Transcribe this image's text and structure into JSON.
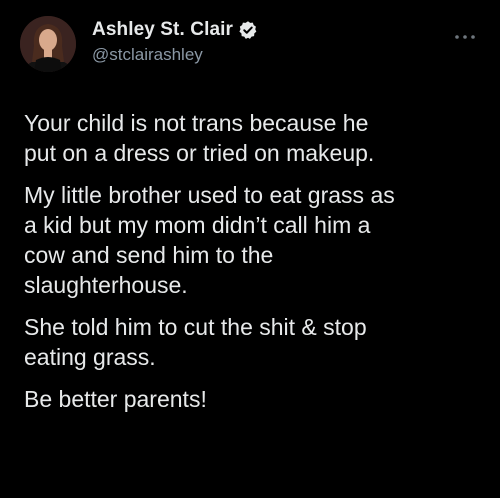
{
  "author": {
    "display_name": "Ashley St. Clair",
    "handle": "@stclairashley"
  },
  "icons": {
    "verified": "verified-badge-icon",
    "more": "more-options-icon"
  },
  "colors": {
    "background": "#000000",
    "text": "#e7e9ea",
    "secondary_text": "#8b98a5"
  },
  "tweet": {
    "paragraphs": [
      "Your child is not trans because he\nput on a dress or tried on makeup.",
      "My little brother used to eat grass as\na kid but my mom didn’t call him a\ncow and send him to the\nslaughterhouse.",
      "She told him to cut the shit & stop\neating grass.",
      "Be better parents!"
    ]
  }
}
